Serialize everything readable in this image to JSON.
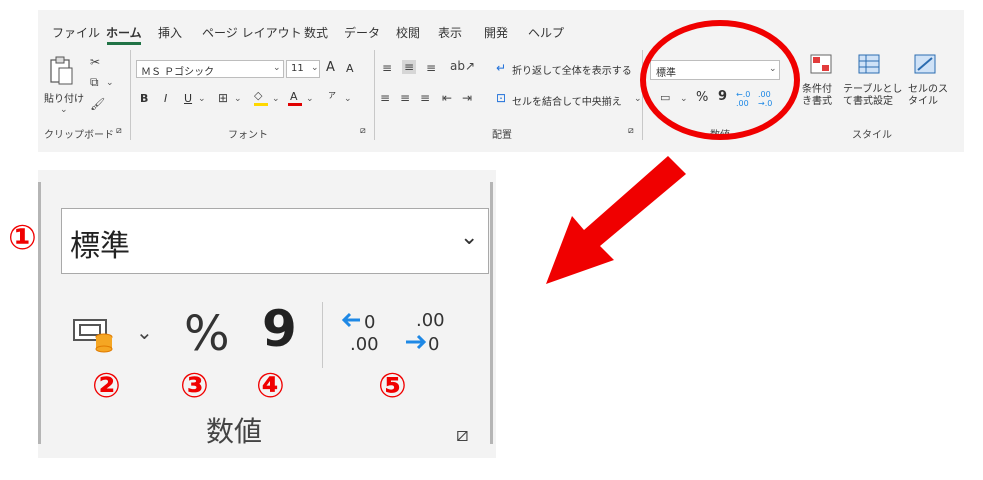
{
  "ribbon": {
    "tabs": [
      "ファイル",
      "ホーム",
      "挿入",
      "ページ レイアウト",
      "数式",
      "データ",
      "校閲",
      "表示",
      "開発",
      "ヘルプ"
    ],
    "clipboard": {
      "paste_label": "貼り付け",
      "group_label": "クリップボード"
    },
    "font": {
      "name": "ＭＳ Ｐゴシック",
      "size": "11",
      "group_label": "フォント",
      "bold": "B",
      "italic": "I",
      "underline": "U",
      "grow": "A",
      "shrink": "A",
      "phonetic": "ア"
    },
    "alignment": {
      "wrap_label": "折り返して全体を表示する",
      "merge_label": "セルを結合して中央揃え",
      "group_label": "配置"
    },
    "number": {
      "format_value": "標準",
      "group_label": "数値",
      "percent": "%",
      "comma": "9"
    },
    "styles": {
      "conditional_label": "条件付き書式",
      "table_label": "テーブルとして書式設定",
      "cell_label": "セルのスタイル",
      "group_label": "スタイル"
    }
  },
  "zoom": {
    "format_value": "標準",
    "percent": "%",
    "comma": "9",
    "group_label": "数値",
    "markers": [
      "①",
      "②",
      "③",
      "④",
      "⑤"
    ],
    "inc_decimal": "←0 .00",
    "dec_decimal": ".00 →0"
  },
  "colors": {
    "highlight": "#f00000",
    "accent": "#1e88e5",
    "excel_green": "#217346"
  }
}
